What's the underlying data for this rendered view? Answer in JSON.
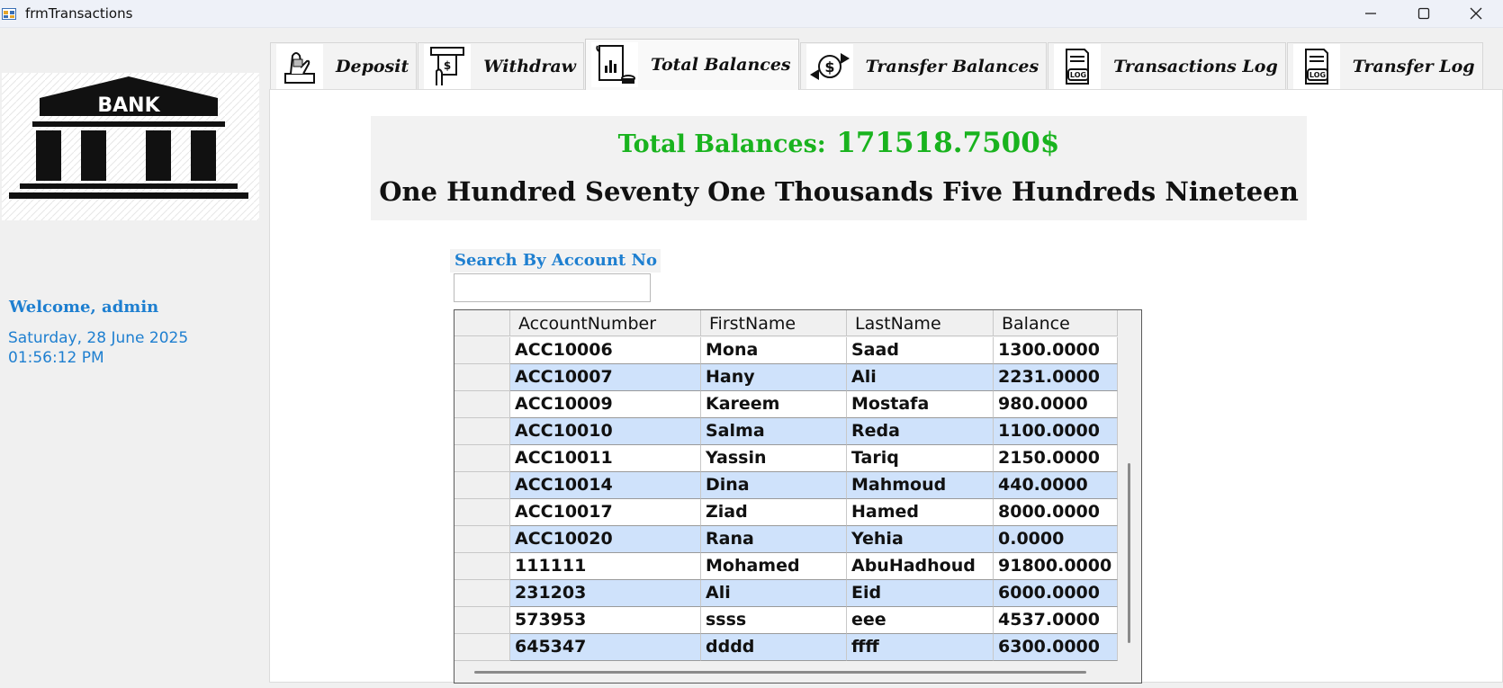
{
  "window": {
    "title": "frmTransactions",
    "icons": [
      "app-icon",
      "minimize-icon",
      "maximize-icon",
      "close-icon"
    ]
  },
  "sidebar": {
    "logo_text": "BANK",
    "welcome": "Welcome, admin",
    "date": "Saturday, 28 June 2025",
    "time": "01:56:12 PM"
  },
  "tabs": [
    {
      "label": "Deposit",
      "icon": "deposit-icon",
      "active": false
    },
    {
      "label": "Withdraw",
      "icon": "atm-withdraw-icon",
      "active": false
    },
    {
      "label": "Total Balances",
      "icon": "report-chart-icon",
      "active": true
    },
    {
      "label": "Transfer Balances",
      "icon": "money-transfer-icon",
      "active": false
    },
    {
      "label": "Transactions Log",
      "icon": "log-document-icon",
      "active": false
    },
    {
      "label": "Transfer Log",
      "icon": "log-document-icon",
      "active": false
    }
  ],
  "summary": {
    "total_label": "Total Balances:",
    "total_value": "171518.7500$",
    "total_words": "One Hundred Seventy One Thousands Five Hundreds Nineteen"
  },
  "search": {
    "label": "Search By Account No",
    "value": ""
  },
  "grid": {
    "columns": [
      "AccountNumber",
      "FirstName",
      "LastName",
      "Balance"
    ],
    "rows": [
      [
        "ACC10006",
        "Mona",
        "Saad",
        "1300.0000"
      ],
      [
        "ACC10007",
        "Hany",
        "Ali",
        "2231.0000"
      ],
      [
        "ACC10009",
        "Kareem",
        "Mostafa",
        "980.0000"
      ],
      [
        "ACC10010",
        "Salma",
        "Reda",
        "1100.0000"
      ],
      [
        "ACC10011",
        "Yassin",
        "Tariq",
        "2150.0000"
      ],
      [
        "ACC10014",
        "Dina",
        "Mahmoud",
        "440.0000"
      ],
      [
        "ACC10017",
        "Ziad",
        "Hamed",
        "8000.0000"
      ],
      [
        "ACC10020",
        "Rana",
        "Yehia",
        "0.0000"
      ],
      [
        "111111",
        "Mohamed",
        "AbuHadhoud",
        "91800.0000"
      ],
      [
        "231203",
        "Ali",
        "Eid",
        "6000.0000"
      ],
      [
        "573953",
        "ssss",
        "eee",
        "4537.0000"
      ],
      [
        "645347",
        "dddd",
        "ffff",
        "6300.0000"
      ]
    ],
    "alt_row_color": "#cfe2fb"
  },
  "colors": {
    "accent_blue": "#1e7fd0",
    "total_green": "#19b31e"
  }
}
